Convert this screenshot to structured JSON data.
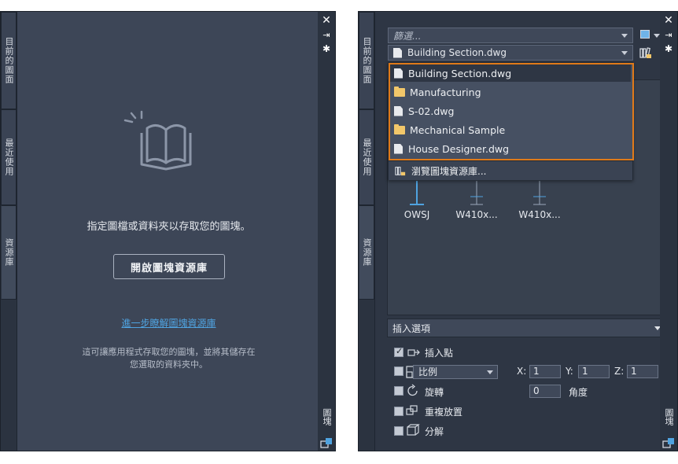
{
  "left": {
    "tabs": [
      "目前的圖面",
      "最近使用",
      "資源庫"
    ],
    "hint": "指定圖檔或資料夾以存取您的圖塊。",
    "open_button": "開啟圖塊資源庫",
    "learn_link": "進一步瞭解圖塊資源庫",
    "desc_line1": "這可讓應用程式存取您的圖塊，並將其儲存在",
    "desc_line2": "您選取的資料夾中。",
    "strip_label": "圖塊",
    "icons": [
      "close-icon",
      "pin-icon",
      "gear-icon",
      "book-icon",
      "blocks-icon"
    ]
  },
  "right": {
    "tabs": [
      "目前的圖面",
      "最近使用",
      "資源庫"
    ],
    "filter_placeholder": "篩選...",
    "file_combo": "Building Section.dwg",
    "dropdown": [
      {
        "label": "Building Section.dwg",
        "icon": "file-icon"
      },
      {
        "label": "Manufacturing",
        "icon": "folder-icon"
      },
      {
        "label": "S-02.dwg",
        "icon": "file-icon"
      },
      {
        "label": "Mechanical Sample",
        "icon": "folder-icon"
      },
      {
        "label": "House Designer.dwg",
        "icon": "file-icon"
      }
    ],
    "browse_label": "瀏覽圖塊資源庫...",
    "thumbs": [
      "OWSJ",
      "W410x...",
      "W410x..."
    ],
    "options_header": "插入選項",
    "insert_point": "插入點",
    "scale": "比例",
    "x_label": "X:",
    "x_val": "1",
    "y_label": "Y:",
    "y_val": "1",
    "z_label": "Z:",
    "z_val": "1",
    "rotate": "旋轉",
    "rotate_val": "0",
    "angle_label": "角度",
    "repeat": "重複放置",
    "explode": "分解",
    "strip_label": "圖塊",
    "accent": "#e07a19",
    "link_color": "#4fa3e0"
  }
}
